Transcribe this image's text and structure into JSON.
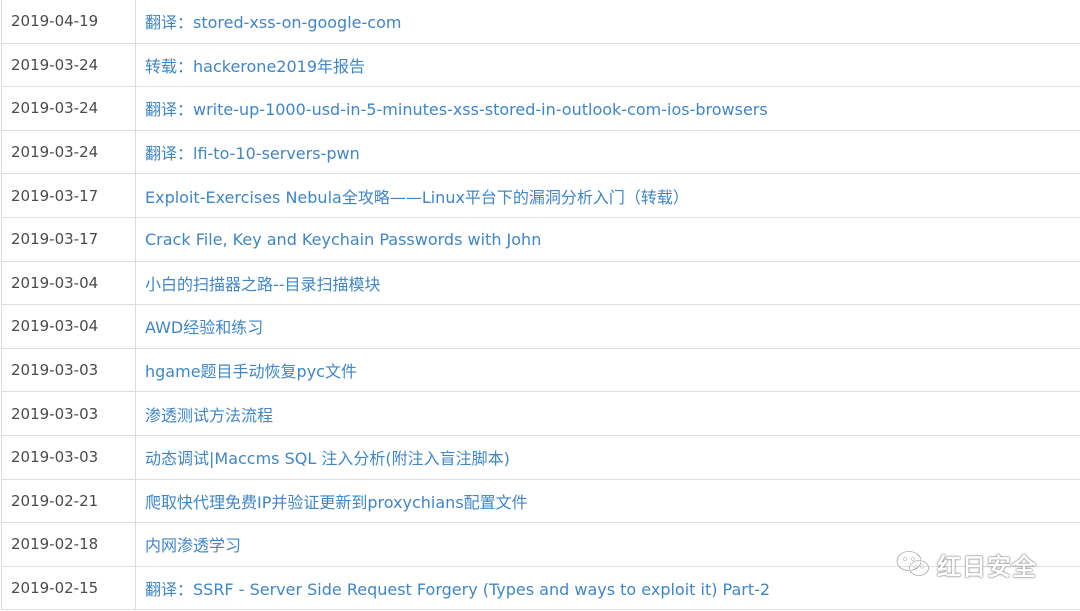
{
  "posts": [
    {
      "date": "2019-04-19",
      "title": "翻译：stored-xss-on-google-com"
    },
    {
      "date": "2019-03-24",
      "title": "转载：hackerone2019年报告"
    },
    {
      "date": "2019-03-24",
      "title": "翻译：write-up-1000-usd-in-5-minutes-xss-stored-in-outlook-com-ios-browsers"
    },
    {
      "date": "2019-03-24",
      "title": "翻译：lfi-to-10-servers-pwn"
    },
    {
      "date": "2019-03-17",
      "title": "Exploit-Exercises Nebula全攻略——Linux平台下的漏洞分析入门（转载）"
    },
    {
      "date": "2019-03-17",
      "title": "Crack File, Key and Keychain Passwords with John"
    },
    {
      "date": "2019-03-04",
      "title": "小白的扫描器之路--目录扫描模块"
    },
    {
      "date": "2019-03-04",
      "title": "AWD经验和练习"
    },
    {
      "date": "2019-03-03",
      "title": "hgame题目手动恢复pyc文件"
    },
    {
      "date": "2019-03-03",
      "title": "渗透测试方法流程"
    },
    {
      "date": "2019-03-03",
      "title": "动态调试|Maccms SQL 注入分析(附注入盲注脚本)"
    },
    {
      "date": "2019-02-21",
      "title": "爬取快代理免费IP并验证更新到proxychians配置文件"
    },
    {
      "date": "2019-02-18",
      "title": "内网渗透学习"
    },
    {
      "date": "2019-02-15",
      "title": "翻译：SSRF - Server Side Request Forgery (Types and ways to exploit it) Part-2"
    }
  ],
  "watermark": {
    "icon": "wechat-icon",
    "text": "红日安全"
  },
  "colors": {
    "link": "#3f86c8",
    "date_text": "#4a4a4a",
    "border": "#dddddd"
  }
}
